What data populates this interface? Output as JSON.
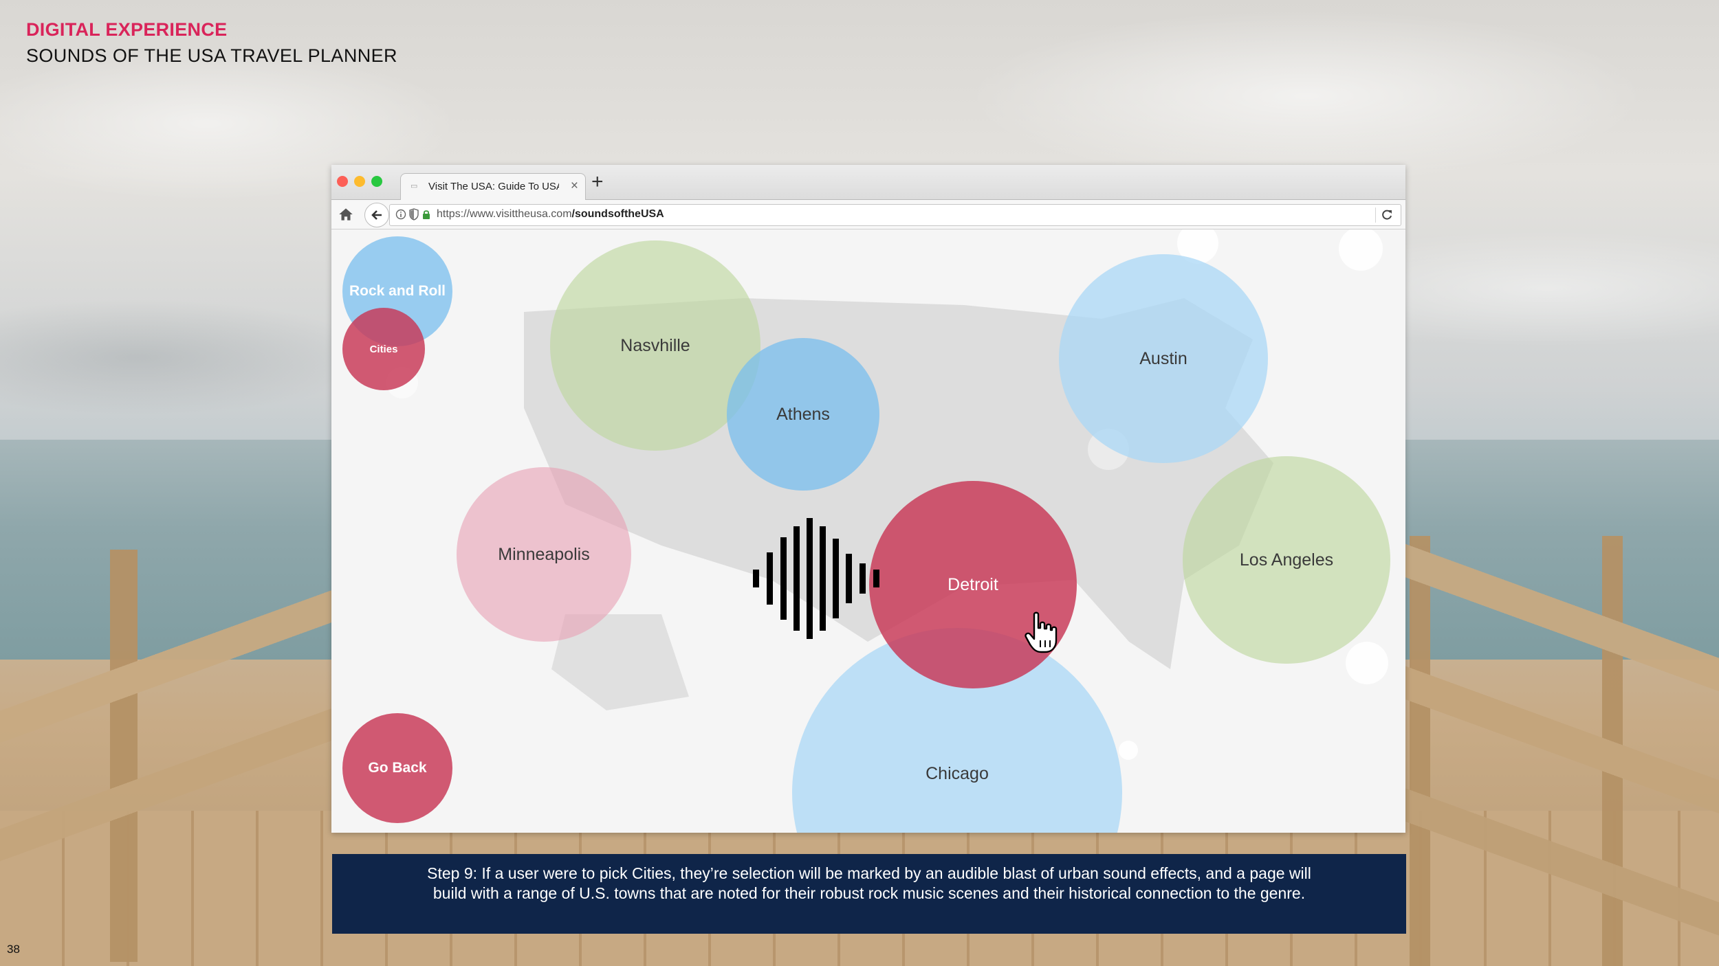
{
  "slide": {
    "kicker": "DIGITAL EXPERIENCE",
    "title": "SOUNDS OF THE USA TRAVEL PLANNER",
    "page_number": "38"
  },
  "browser": {
    "tab_title": "Visit The USA: Guide To USA H",
    "new_tab_icon": "plus-icon",
    "url_host": "https://www.visittheusa.com",
    "url_path": "/soundsoftheUSA"
  },
  "menu": {
    "genre_label": "Rock and Roll",
    "category_label": "Cities",
    "back_label": "Go Back"
  },
  "cities": {
    "nashville": "Nasvhille",
    "athens": "Athens",
    "austin": "Austin",
    "minneapolis": "Minneapolis",
    "detroit": "Detroit",
    "los_angeles": "Los Angeles",
    "chicago": "Chicago"
  },
  "caption": "Step 9: If a user were to pick Cities, they’re selection will be marked by an audible blast of urban sound effects, and a page will build with a range of U.S. towns that are noted for their robust rock music scenes and their historical connection to the genre.",
  "colors": {
    "accent": "#d9245a",
    "bubble_crimson": "#c83755",
    "bubble_blue": "#78beee",
    "bubble_green": "#bed7a0",
    "caption_bg": "#0f2549"
  }
}
